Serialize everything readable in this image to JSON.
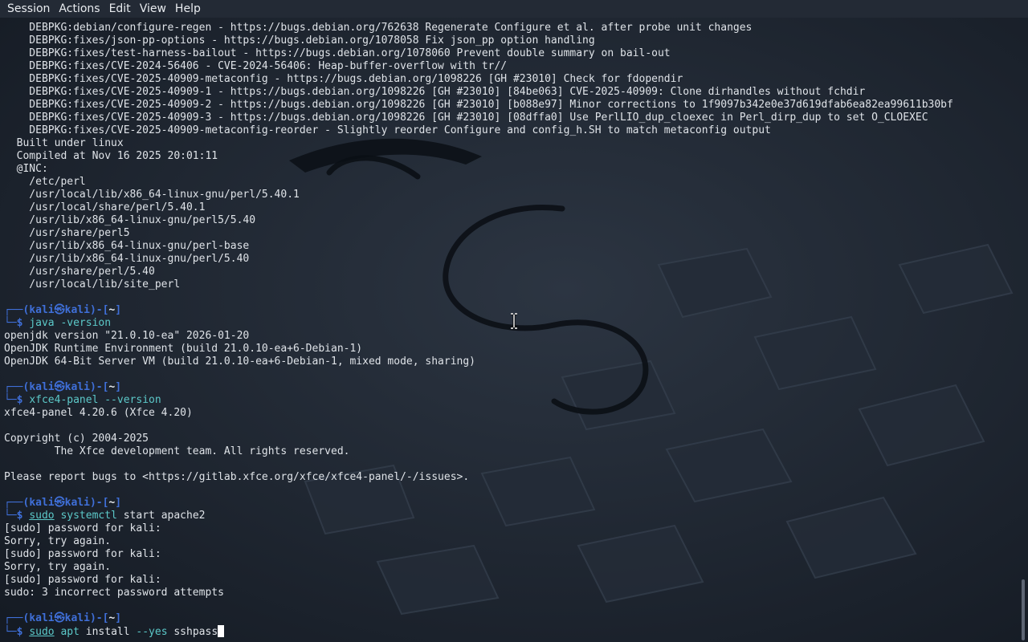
{
  "menubar": {
    "items": [
      "Session",
      "Actions",
      "Edit",
      "View",
      "Help"
    ]
  },
  "colors": {
    "prompt_blue": "#3f6fd8",
    "command_cyan": "#5cc9c9",
    "text": "#dfe3e8",
    "background": "#1d2430"
  },
  "icons": {
    "cursor": "text-cursor-ibeam-icon"
  },
  "terminal": {
    "lines": [
      {
        "type": "text",
        "text": "    DEBPKG:debian/configure-regen - https://bugs.debian.org/762638 Regenerate Configure et al. after probe unit changes"
      },
      {
        "type": "text",
        "text": "    DEBPKG:fixes/json-pp-options - https://bugs.debian.org/1078058 Fix json_pp option handling"
      },
      {
        "type": "text",
        "text": "    DEBPKG:fixes/test-harness-bailout - https://bugs.debian.org/1078060 Prevent double summary on bail-out"
      },
      {
        "type": "text",
        "text": "    DEBPKG:fixes/CVE-2024-56406 - CVE-2024-56406: Heap-buffer-overflow with tr//"
      },
      {
        "type": "text",
        "text": "    DEBPKG:fixes/CVE-2025-40909-metaconfig - https://bugs.debian.org/1098226 [GH #23010] Check for fdopendir"
      },
      {
        "type": "text",
        "text": "    DEBPKG:fixes/CVE-2025-40909-1 - https://bugs.debian.org/1098226 [GH #23010] [84be063] CVE-2025-40909: Clone dirhandles without fchdir"
      },
      {
        "type": "text",
        "text": "    DEBPKG:fixes/CVE-2025-40909-2 - https://bugs.debian.org/1098226 [GH #23010] [b088e97] Minor corrections to 1f9097b342e0e37d619dfab6ea82ea99611b30bf"
      },
      {
        "type": "text",
        "text": "    DEBPKG:fixes/CVE-2025-40909-3 - https://bugs.debian.org/1098226 [GH #23010] [08dffa0] Use PerlLIO_dup_cloexec in Perl_dirp_dup to set O_CLOEXEC"
      },
      {
        "type": "text",
        "text": "    DEBPKG:fixes/CVE-2025-40909-metaconfig-reorder - Slightly reorder Configure and config_h.SH to match metaconfig output"
      },
      {
        "type": "text",
        "text": "  Built under linux"
      },
      {
        "type": "text",
        "text": "  Compiled at Nov 16 2025 20:01:11"
      },
      {
        "type": "text",
        "text": "  @INC:"
      },
      {
        "type": "text",
        "text": "    /etc/perl"
      },
      {
        "type": "text",
        "text": "    /usr/local/lib/x86_64-linux-gnu/perl/5.40.1"
      },
      {
        "type": "text",
        "text": "    /usr/local/share/perl/5.40.1"
      },
      {
        "type": "text",
        "text": "    /usr/lib/x86_64-linux-gnu/perl5/5.40"
      },
      {
        "type": "text",
        "text": "    /usr/share/perl5"
      },
      {
        "type": "text",
        "text": "    /usr/lib/x86_64-linux-gnu/perl-base"
      },
      {
        "type": "text",
        "text": "    /usr/lib/x86_64-linux-gnu/perl/5.40"
      },
      {
        "type": "text",
        "text": "    /usr/share/perl/5.40"
      },
      {
        "type": "text",
        "text": "    /usr/local/lib/site_perl"
      },
      {
        "type": "blank"
      },
      {
        "type": "prompt",
        "frame_top": "┌──(",
        "user": "kali㉿kali",
        "mid": ")-[",
        "dir": "~",
        "end": "]"
      },
      {
        "type": "command",
        "frame_bottom": "└─$ ",
        "parts": [
          {
            "t": "java",
            "c": "main"
          },
          {
            "t": " -version",
            "c": "flag"
          }
        ]
      },
      {
        "type": "text",
        "text": "openjdk version \"21.0.10-ea\" 2026-01-20"
      },
      {
        "type": "text",
        "text": "OpenJDK Runtime Environment (build 21.0.10-ea+6-Debian-1)"
      },
      {
        "type": "text",
        "text": "OpenJDK 64-Bit Server VM (build 21.0.10-ea+6-Debian-1, mixed mode, sharing)"
      },
      {
        "type": "blank"
      },
      {
        "type": "prompt",
        "frame_top": "┌──(",
        "user": "kali㉿kali",
        "mid": ")-[",
        "dir": "~",
        "end": "]"
      },
      {
        "type": "command",
        "frame_bottom": "└─$ ",
        "parts": [
          {
            "t": "xfce4-panel",
            "c": "main"
          },
          {
            "t": " --version",
            "c": "flag"
          }
        ]
      },
      {
        "type": "text",
        "text": "xfce4-panel 4.20.6 (Xfce 4.20)"
      },
      {
        "type": "blank"
      },
      {
        "type": "text",
        "text": "Copyright (c) 2004-2025"
      },
      {
        "type": "text",
        "text": "        The Xfce development team. All rights reserved."
      },
      {
        "type": "blank"
      },
      {
        "type": "text",
        "text": "Please report bugs to <https://gitlab.xfce.org/xfce/xfce4-panel/-/issues>."
      },
      {
        "type": "blank"
      },
      {
        "type": "prompt",
        "frame_top": "┌──(",
        "user": "kali㉿kali",
        "mid": ")-[",
        "dir": "~",
        "end": "]"
      },
      {
        "type": "command",
        "frame_bottom": "└─$ ",
        "parts": [
          {
            "t": "sudo",
            "c": "sudo"
          },
          {
            "t": " ",
            "c": "arg"
          },
          {
            "t": "systemctl",
            "c": "main"
          },
          {
            "t": " start apache2",
            "c": "arg"
          }
        ]
      },
      {
        "type": "text",
        "text": "[sudo] password for kali:"
      },
      {
        "type": "text",
        "text": "Sorry, try again."
      },
      {
        "type": "text",
        "text": "[sudo] password for kali:"
      },
      {
        "type": "text",
        "text": "Sorry, try again."
      },
      {
        "type": "text",
        "text": "[sudo] password for kali:"
      },
      {
        "type": "text",
        "text": "sudo: 3 incorrect password attempts"
      },
      {
        "type": "blank"
      },
      {
        "type": "prompt",
        "frame_top": "┌──(",
        "user": "kali㉿kali",
        "mid": ")-[",
        "dir": "~",
        "end": "]"
      },
      {
        "type": "command",
        "frame_bottom": "└─$ ",
        "cursor": true,
        "parts": [
          {
            "t": "sudo",
            "c": "sudo"
          },
          {
            "t": " ",
            "c": "arg"
          },
          {
            "t": "apt",
            "c": "main"
          },
          {
            "t": " install ",
            "c": "arg"
          },
          {
            "t": "--yes",
            "c": "flag"
          },
          {
            "t": " sshpass",
            "c": "arg"
          }
        ]
      }
    ]
  }
}
